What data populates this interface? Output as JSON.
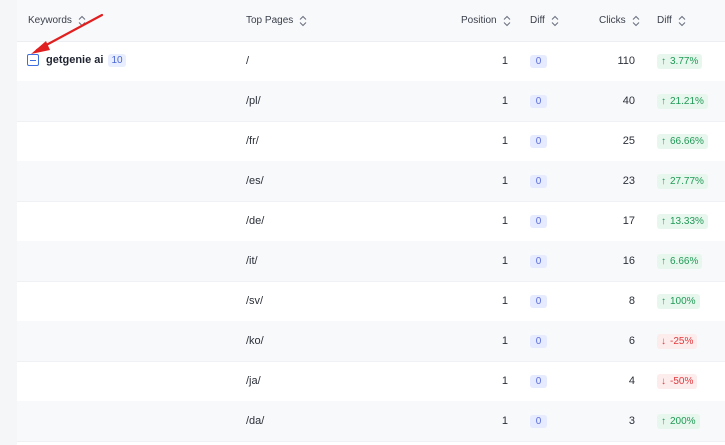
{
  "columns": {
    "keywords": "Keywords",
    "top_pages": "Top Pages",
    "position": "Position",
    "position_diff": "Diff",
    "clicks": "Clicks",
    "clicks_diff": "Diff"
  },
  "group": {
    "keyword": "getgenie ai",
    "count": "10",
    "expanded": true
  },
  "colors": {
    "up": "#1f9a55",
    "down": "#e0393e",
    "accent": "#3d6fe0",
    "annotation_arrow": "#e02020"
  },
  "rows": [
    {
      "page": "/",
      "position": "1",
      "position_diff": "0",
      "clicks": "110",
      "diff": "3.77%",
      "trend": "up"
    },
    {
      "page": "/pl/",
      "position": "1",
      "position_diff": "0",
      "clicks": "40",
      "diff": "21.21%",
      "trend": "up"
    },
    {
      "page": "/fr/",
      "position": "1",
      "position_diff": "0",
      "clicks": "25",
      "diff": "66.66%",
      "trend": "up"
    },
    {
      "page": "/es/",
      "position": "1",
      "position_diff": "0",
      "clicks": "23",
      "diff": "27.77%",
      "trend": "up"
    },
    {
      "page": "/de/",
      "position": "1",
      "position_diff": "0",
      "clicks": "17",
      "diff": "13.33%",
      "trend": "up"
    },
    {
      "page": "/it/",
      "position": "1",
      "position_diff": "0",
      "clicks": "16",
      "diff": "6.66%",
      "trend": "up"
    },
    {
      "page": "/sv/",
      "position": "1",
      "position_diff": "0",
      "clicks": "8",
      "diff": "100%",
      "trend": "up"
    },
    {
      "page": "/ko/",
      "position": "1",
      "position_diff": "0",
      "clicks": "6",
      "diff": "-25%",
      "trend": "down"
    },
    {
      "page": "/ja/",
      "position": "1",
      "position_diff": "0",
      "clicks": "4",
      "diff": "-50%",
      "trend": "down"
    },
    {
      "page": "/da/",
      "position": "1",
      "position_diff": "0",
      "clicks": "3",
      "diff": "200%",
      "trend": "up"
    }
  ]
}
